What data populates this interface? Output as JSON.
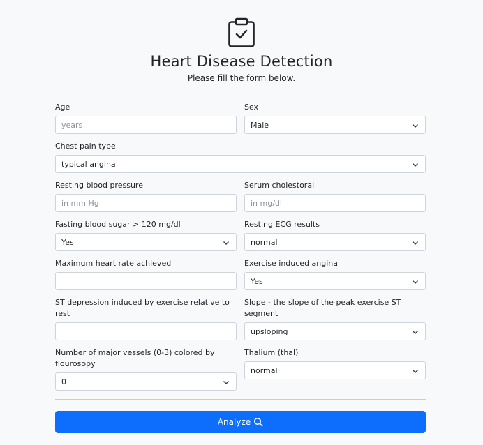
{
  "header": {
    "title": "Heart Disease Detection",
    "subtitle": "Please fill the form below.",
    "icon": "clipboard-check-icon"
  },
  "fields": {
    "age": {
      "label": "Age",
      "placeholder": "years",
      "value": ""
    },
    "sex": {
      "label": "Sex",
      "value": "Male"
    },
    "chest_pain": {
      "label": "Chest pain type",
      "value": "typical angina"
    },
    "resting_bp": {
      "label": "Resting blood pressure",
      "placeholder": "in mm Hg",
      "value": ""
    },
    "cholesterol": {
      "label": "Serum cholestoral",
      "placeholder": "in mg/dl",
      "value": ""
    },
    "fbs": {
      "label": "Fasting blood sugar > 120 mg/dl",
      "value": "Yes"
    },
    "restecg": {
      "label": "Resting ECG results",
      "value": "normal"
    },
    "max_hr": {
      "label": "Maximum heart rate achieved",
      "placeholder": "",
      "value": ""
    },
    "exang": {
      "label": "Exercise induced angina",
      "value": "Yes"
    },
    "oldpeak": {
      "label": "ST depression induced by exercise relative to rest",
      "placeholder": "",
      "value": ""
    },
    "slope": {
      "label": "Slope - the slope of the peak exercise ST segment",
      "value": "upsloping"
    },
    "ca": {
      "label": "Number of major vessels (0-3) colored by flourosopy",
      "value": "0"
    },
    "thal": {
      "label": "Thalium (thal)",
      "value": "normal"
    }
  },
  "analyze_button": {
    "label": "Analyze",
    "icon": "search-icon"
  },
  "colors": {
    "primary": "#0d6efd",
    "background": "#f8f9fa",
    "border": "#ced4da"
  }
}
